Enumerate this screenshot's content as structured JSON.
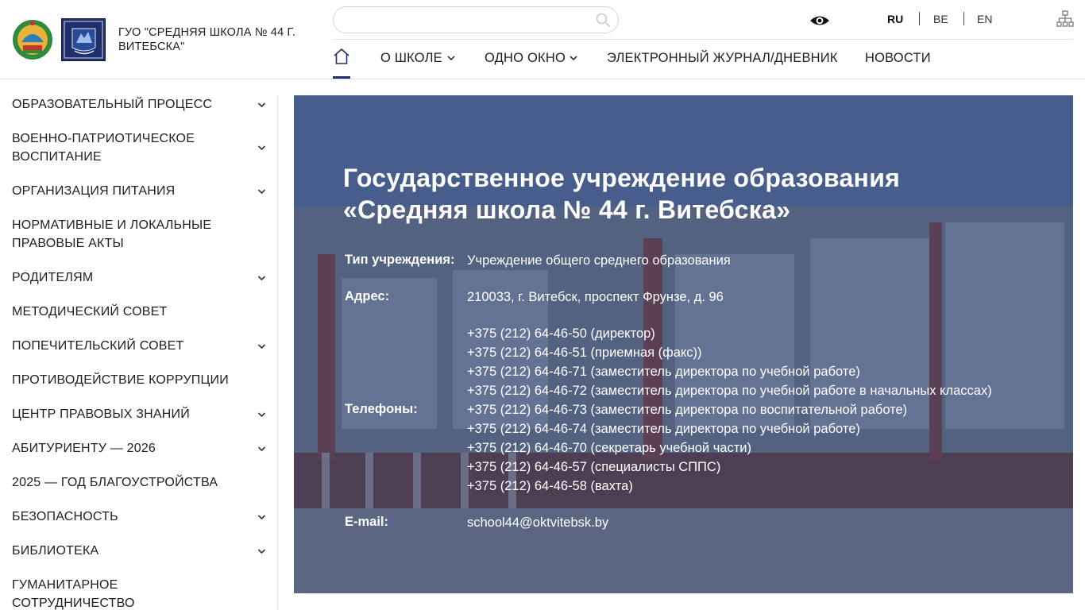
{
  "header": {
    "school_name": "ГУО \"СРЕДНЯЯ ШКОЛА № 44 Г. ВИТЕБСКА\"",
    "search": {
      "placeholder": "",
      "value": ""
    },
    "languages": [
      {
        "code": "RU",
        "active": true
      },
      {
        "code": "BE",
        "active": false
      },
      {
        "code": "EN",
        "active": false
      }
    ],
    "icons": {
      "accessibility": "eye-icon",
      "sitemap": "sitemap-icon",
      "search": "search-icon",
      "home": "home-icon"
    },
    "nav": [
      {
        "label": "О ШКОЛЕ",
        "has_dropdown": true
      },
      {
        "label": "ОДНО ОКНО",
        "has_dropdown": true
      },
      {
        "label": "ЭЛЕКТРОННЫЙ ЖУРНАЛ/ДНЕВНИК",
        "has_dropdown": false
      },
      {
        "label": "НОВОСТИ",
        "has_dropdown": false
      }
    ]
  },
  "sidebar": {
    "items": [
      {
        "label": "ОБРАЗОВАТЕЛЬНЫЙ ПРОЦЕСС",
        "has_dropdown": true
      },
      {
        "label": "ВОЕННО-ПАТРИОТИЧЕСКОЕ ВОСПИТАНИЕ",
        "has_dropdown": true
      },
      {
        "label": "ОРГАНИЗАЦИЯ ПИТАНИЯ",
        "has_dropdown": true
      },
      {
        "label": "НОРМАТИВНЫЕ И ЛОКАЛЬНЫЕ ПРАВОВЫЕ АКТЫ",
        "has_dropdown": false
      },
      {
        "label": "РОДИТЕЛЯМ",
        "has_dropdown": true
      },
      {
        "label": "МЕТОДИЧЕСКИЙ СОВЕТ",
        "has_dropdown": false
      },
      {
        "label": "ПОПЕЧИТЕЛЬСКИЙ СОВЕТ",
        "has_dropdown": true
      },
      {
        "label": "ПРОТИВОДЕЙСТВИЕ КОРРУПЦИИ",
        "has_dropdown": false
      },
      {
        "label": "ЦЕНТР ПРАВОВЫХ ЗНАНИЙ",
        "has_dropdown": true
      },
      {
        "label": "АБИТУРИЕНТУ — 2026",
        "has_dropdown": true
      },
      {
        "label": "2025 — ГОД БЛАГОУСТРОЙСТВА",
        "has_dropdown": false
      },
      {
        "label": "БЕЗОПАСНОСТЬ",
        "has_dropdown": true
      },
      {
        "label": "БИБЛИОТЕКА",
        "has_dropdown": true
      },
      {
        "label": "ГУМАНИТАРНОЕ СОТРУДНИЧЕСТВО",
        "has_dropdown": false
      }
    ]
  },
  "hero": {
    "title_line1": "Государственное учреждение образования",
    "title_line2": "«Средняя школа № 44 г. Витебска»",
    "type_label": "Тип учреждения:",
    "type_value": "Учреждение общего среднего образования",
    "address_label": "Адрес:",
    "address_value": "210033, г. Витебск, проспект Фрунзе, д. 96",
    "phones_label": "Телефоны:",
    "phones": [
      "+375 (212) 64-46-50 (директор)",
      "+375 (212) 64-46-51 (приемная (факс))",
      "+375 (212) 64-46-71 (заместитель директора по учебной работе)",
      "+375 (212) 64-46-72 (заместитель директора по учебной работе в начальных классах)",
      "+375 (212) 64-46-73 (заместитель директора по воспитательной работе)",
      "+375 (212) 64-46-74 (заместитель директора по учебной работе)",
      "+375 (212) 64-46-70 (секретарь учебной части)",
      "+375 (212) 64-46-57 (специалисты СППС)",
      "+375 (212) 64-46-58 (вахта)"
    ],
    "email_label": "E-mail:",
    "email_value": "school44@oktvitebsk.by"
  },
  "colors": {
    "brand": "#1f2f6b",
    "overlay": "#263762",
    "text": "#1f1f1f"
  }
}
